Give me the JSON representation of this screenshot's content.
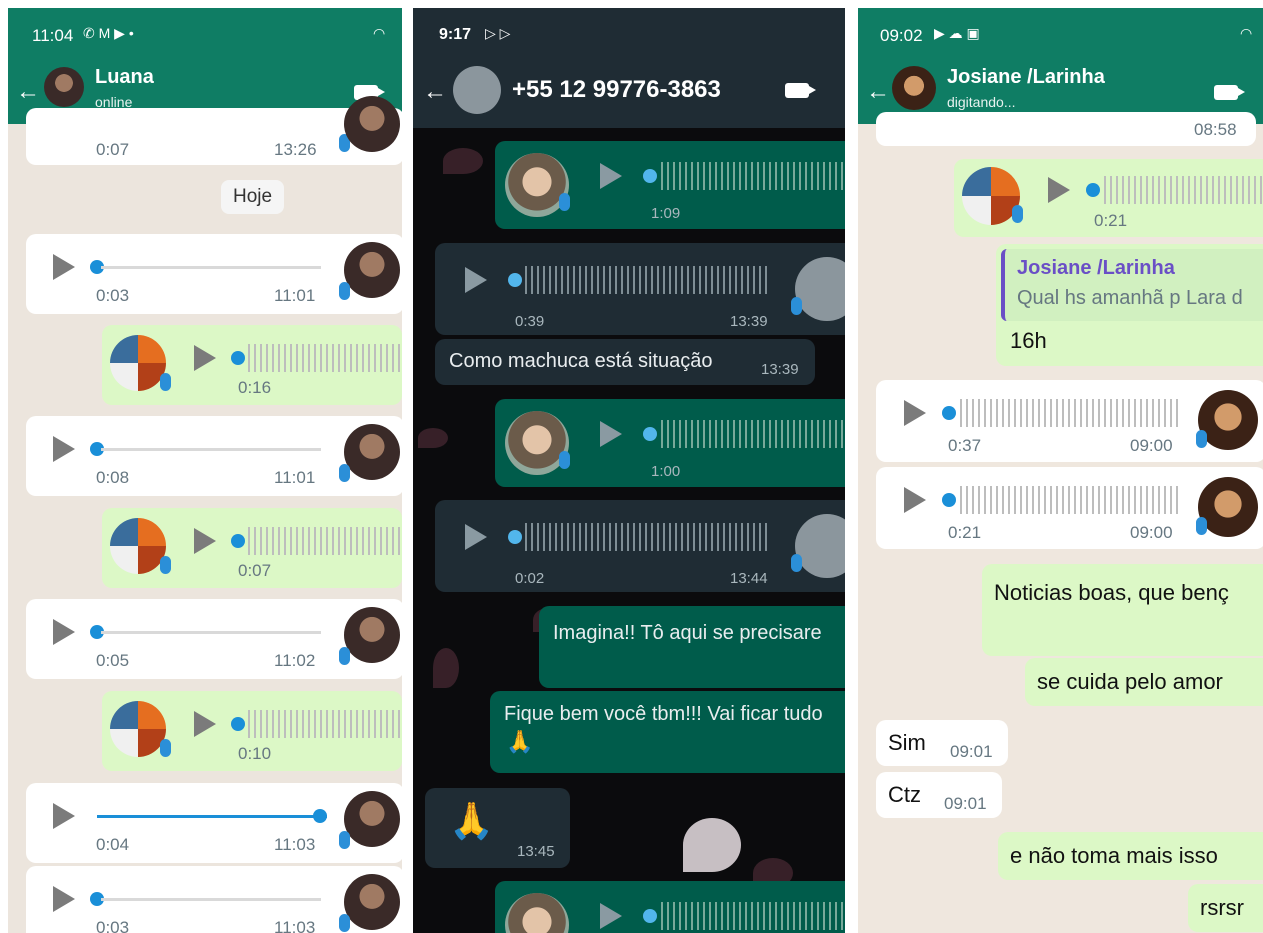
{
  "panel1": {
    "status_time": "11:04",
    "status_icons": "✆ M ▶ •",
    "contact_name": "Luana",
    "contact_status": "online",
    "day_chip": "Hoje",
    "voice_messages": [
      {
        "dur": "0:07",
        "time": "13:26"
      },
      {
        "dur": "0:03",
        "time": "11:01"
      },
      {
        "dur": "0:16",
        "time": ""
      },
      {
        "dur": "0:08",
        "time": "11:01"
      },
      {
        "dur": "0:07",
        "time": ""
      },
      {
        "dur": "0:05",
        "time": "11:02"
      },
      {
        "dur": "0:10",
        "time": ""
      },
      {
        "dur": "0:04",
        "time": "11:03"
      },
      {
        "dur": "0:03",
        "time": "11:03"
      }
    ]
  },
  "panel2": {
    "status_time": "9:17",
    "status_icons": "▷ ▷",
    "contact_name": "+55 12 99776-3863",
    "voice_messages": [
      {
        "dur": "1:09",
        "time": ""
      },
      {
        "dur": "0:39",
        "time": "13:39"
      },
      {
        "dur": "1:00",
        "time": ""
      },
      {
        "dur": "0:02",
        "time": "13:44"
      }
    ],
    "text_messages": [
      {
        "text": "Como machuca está situação",
        "time": "13:39"
      },
      {
        "text": "Imagina!! Tô aqui se precisare",
        "time": ""
      },
      {
        "text": "Fique bem você tbm!!! Vai ficar tudo",
        "time": ""
      },
      {
        "text": "🙏",
        "time": ""
      },
      {
        "text": "🙏",
        "time": "13:45"
      }
    ]
  },
  "panel3": {
    "status_time": "09:02",
    "status_icons": "▶ ☁ ▣",
    "contact_name": "Josiane /Larinha",
    "contact_status": "digitando...",
    "top_time": "08:58",
    "voice_messages": [
      {
        "dur": "0:21",
        "time": ""
      },
      {
        "dur": "0:37",
        "time": "09:00"
      },
      {
        "dur": "0:21",
        "time": "09:00"
      }
    ],
    "quote": {
      "author": "Josiane /Larinha",
      "text": "Qual hs amanhã p Lara d"
    },
    "reply_text": "16h",
    "text_messages": [
      {
        "text": "Noticias boas, que benç",
        "time": ""
      },
      {
        "text": "se cuida pelo amor",
        "time": ""
      },
      {
        "text": "Sim",
        "time": "09:01"
      },
      {
        "text": "Ctz",
        "time": "09:01"
      },
      {
        "text": "e não toma mais isso",
        "time": ""
      },
      {
        "text": "rsrsr",
        "time": ""
      }
    ]
  },
  "colors": {
    "whatsapp_green": "#0f7d64",
    "dark_header": "#1f2c34",
    "out_bubble": "#dcf8c6",
    "dark_out": "#005c4b"
  }
}
